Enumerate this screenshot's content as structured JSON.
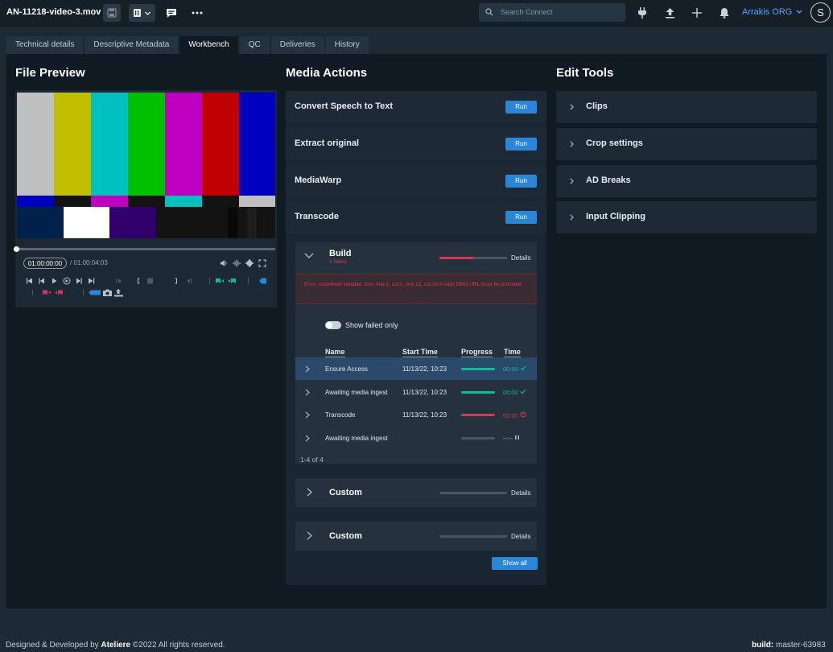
{
  "topbar": {
    "filename": "AN-11218-video-3.mov",
    "search_placeholder": "Search Connect",
    "org": "Arrakis ORG",
    "avatar_initial": "S",
    "icons": [
      "save-icon",
      "delete-icon",
      "chevron-down-icon",
      "comment-icon",
      "more-icon",
      "search-icon",
      "plug-icon",
      "upload-icon",
      "plus-icon",
      "bell-icon"
    ]
  },
  "tabs": [
    "Technical details",
    "Descriptive Metadata",
    "Workbench",
    "QC",
    "Deliveries",
    "History"
  ],
  "active_tab": "Workbench",
  "file_preview": {
    "title": "File Preview",
    "current_timecode": "01:00:00:00",
    "separator": "/",
    "duration": "01:00:04:03",
    "playhead_fraction": 0
  },
  "media_actions": {
    "title": "Media Actions",
    "actions": [
      {
        "label": "Convert Speech to Text",
        "button": "Run"
      },
      {
        "label": "Extract original",
        "button": "Run"
      },
      {
        "label": "MediaWarp",
        "button": "Run"
      },
      {
        "label": "Transcode",
        "button": "Run"
      }
    ],
    "workflows": [
      {
        "name": "Build",
        "status": "1 failed",
        "details": "Details",
        "progress": 0.5,
        "error": "Error: undefined variable: drm, line:1, col:1, line:13, col:24 A valid DRM URL must be provided",
        "toggle_label": "Show failed only",
        "columns": [
          "Name",
          "Start Time",
          "Progress",
          "Time"
        ],
        "rows": [
          {
            "name": "Ensure Access",
            "start": "11/13/22, 10:23",
            "time": "00:00",
            "status_icon": "check-icon",
            "progress": 1
          },
          {
            "name": "Awaiting media ingest",
            "start": "11/13/22, 10:23",
            "time": "00:00",
            "status_icon": "check-icon",
            "progress": 1
          },
          {
            "name": "Transcode",
            "start": "11/13/22, 10:23",
            "time": "00:00",
            "status_icon": "error-icon",
            "progress": 1
          },
          {
            "name": "Awaiting media ingest",
            "start": "",
            "time": "--:--",
            "status_icon": "pause-icon",
            "progress": 0
          }
        ],
        "pagination": "1-4 of 4"
      },
      {
        "name": "Custom",
        "details": "Details",
        "progress": 0
      },
      {
        "name": "Custom",
        "details": "Details",
        "progress": 0
      }
    ],
    "show_all": "Show all"
  },
  "edit_tools": {
    "title": "Edit Tools",
    "items": [
      "Clips",
      "Crop settings",
      "AD Breaks",
      "Input Clipping"
    ]
  },
  "footer": {
    "left_prefix": "Designed & Developed by",
    "brand": "Ateliere",
    "left_suffix": "©2022 All rights reserved.",
    "build_label": "build:",
    "build_value": "master-63983"
  },
  "colors": {
    "accent": "#2b86d8",
    "success": "#14b89c",
    "error": "#d13a55",
    "link": "#5aa3ff"
  }
}
